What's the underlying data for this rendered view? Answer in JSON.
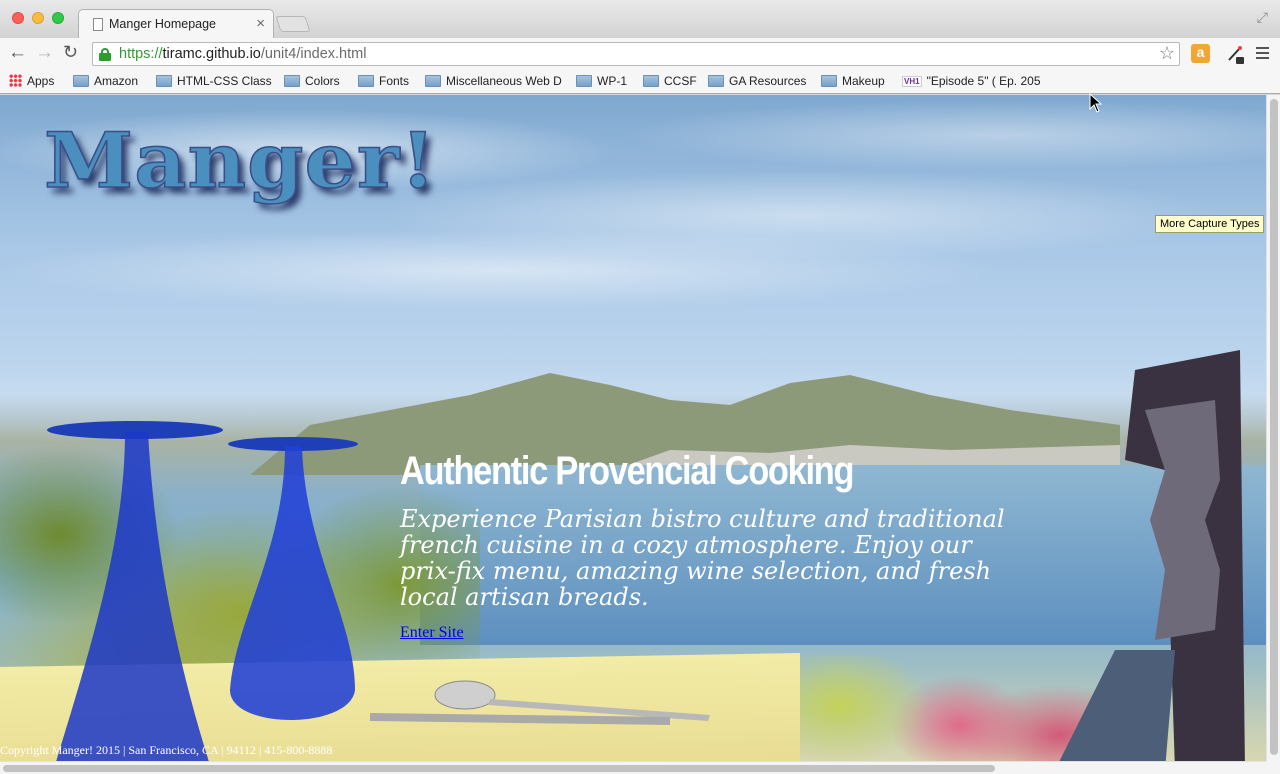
{
  "browser": {
    "tab_title": "Manger Homepage",
    "tab_close": "×",
    "url": {
      "scheme": "https://",
      "host": "tiramc.github.io",
      "path": "/unit4/index.html"
    },
    "nav": {
      "back": "←",
      "forward": "→",
      "reload": "↻",
      "star": "☆"
    },
    "amazon_ext": "a",
    "expand": "⤢",
    "bookmarks": {
      "apps": "Apps",
      "amazon": "Amazon",
      "html_css": "HTML-CSS Class",
      "colors": "Colors",
      "fonts": "Fonts",
      "misc": "Miscellaneous Web D",
      "wp1": "WP-1",
      "ccsf": "CCSF",
      "ga": "GA Resources",
      "makeup": "Makeup",
      "vh1_badge": "VH1",
      "episode": "\"Episode 5\" ( Ep. 205"
    },
    "tooltip": "More Capture Types"
  },
  "page": {
    "logo": "Manger!",
    "heading": "Authentic Provencial Cooking",
    "description": "Experience Parisian bistro culture and traditional french cuisine in a cozy atmosphere. Enjoy our prix-fix menu, amazing wine selection, and fresh local artisan breads.",
    "enter_link": "Enter Site",
    "footer": "Copyright Manger! 2015 | San Francisco, CA | 94112 | 415-800-8888"
  },
  "colors": {
    "link": "#0000ee",
    "logo_fill": "#4a8fbd",
    "secure_green": "#2f9c2f"
  }
}
